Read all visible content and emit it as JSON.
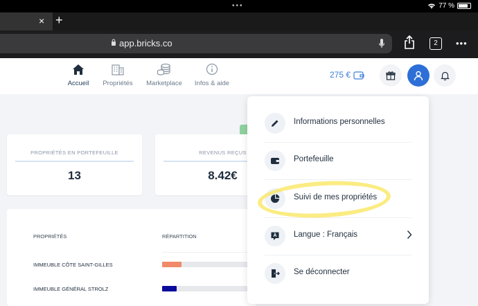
{
  "status_bar": {
    "battery": "77 %"
  },
  "browser": {
    "url": "app.bricks.co",
    "tab_count": "2",
    "close_tab": "×",
    "new_tab": "+"
  },
  "nav": {
    "items": [
      {
        "label": "Accueil",
        "icon": "home-icon",
        "active": true
      },
      {
        "label": "Propriétés",
        "icon": "building-icon",
        "active": false
      },
      {
        "label": "Marketplace",
        "icon": "coins-icon",
        "active": false
      },
      {
        "label": "Infos & aide",
        "icon": "info-icon",
        "active": false
      }
    ],
    "balance": "275 €"
  },
  "cards": [
    {
      "label": "PROPRIÉTÉS EN PORTEFEUILLE",
      "value": "13"
    },
    {
      "label": "REVENUS REÇUS",
      "value": "8.42€"
    }
  ],
  "table": {
    "headers": {
      "properties": "PROPRIÉTÉS",
      "distribution": "RÉPARTITION"
    },
    "rows": [
      {
        "name": "IMMEUBLE CÔTE SAINT-GILLES",
        "share": 0.22,
        "color": "#f08a6a"
      },
      {
        "name": "IMMEUBLE GÉNÉRAL STROLZ",
        "share": 0.17,
        "color": "#0a0a9c"
      }
    ]
  },
  "menu": {
    "items": [
      {
        "label": "Informations personnelles",
        "icon": "pencil-icon"
      },
      {
        "label": "Portefeuille",
        "icon": "wallet-icon"
      },
      {
        "label": "Suivi de mes propriétés",
        "icon": "pie-chart-icon"
      },
      {
        "label": "Langue : Français",
        "icon": "language-icon"
      },
      {
        "label": "Se déconnecter",
        "icon": "logout-icon"
      }
    ]
  },
  "colors": {
    "accent": "#2d6fd6",
    "balance": "#3e7fd6",
    "highlight": "#fae65a"
  }
}
